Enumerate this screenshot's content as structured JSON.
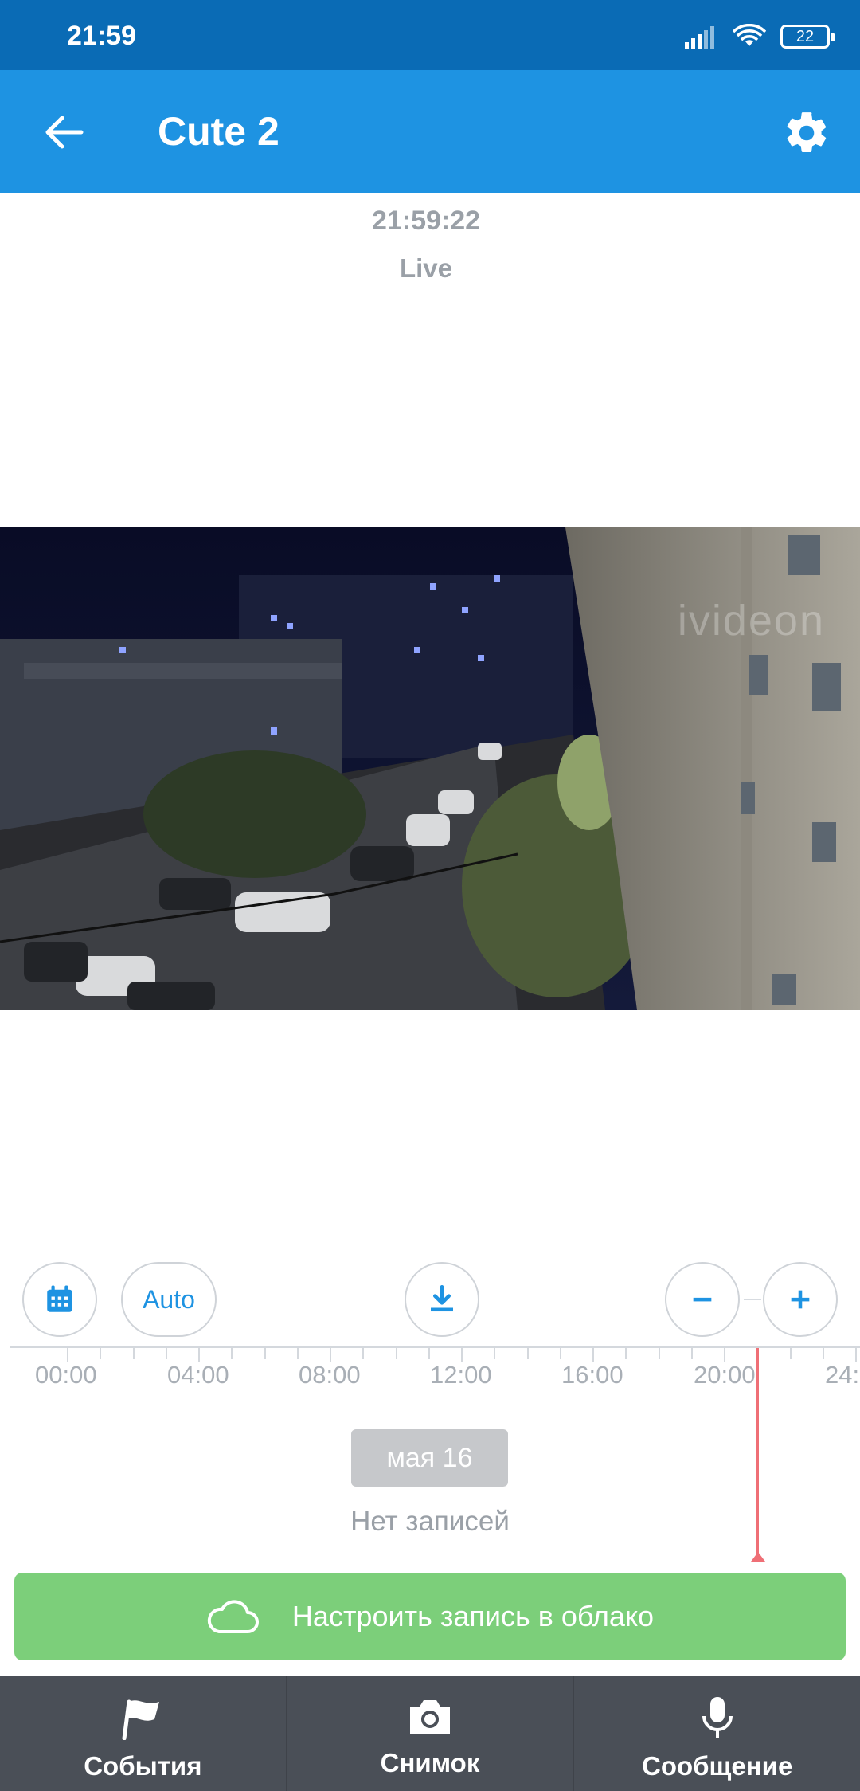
{
  "status_bar": {
    "time": "21:59",
    "battery": "22"
  },
  "app_bar": {
    "title": "Cute 2"
  },
  "player": {
    "clock": "21:59:22",
    "mode": "Live",
    "watermark": "ivideon"
  },
  "controls": {
    "auto_label": "Auto"
  },
  "timeline": {
    "labels": [
      "00:00",
      "04:00",
      "08:00",
      "12:00",
      "16:00",
      "20:00",
      "24:"
    ],
    "date": "мая 16",
    "empty_text": "Нет записей"
  },
  "cloud_button": {
    "label": "Настроить запись в облако"
  },
  "bottom_nav": {
    "events": "События",
    "snapshot": "Снимок",
    "message": "Сообщение"
  },
  "colors": {
    "status_bar": "#0a6bb5",
    "app_bar": "#1e93e2",
    "cloud_green": "#7ccf7a",
    "now_marker": "#ef6f76",
    "bottom_bar": "#4a4f57"
  }
}
